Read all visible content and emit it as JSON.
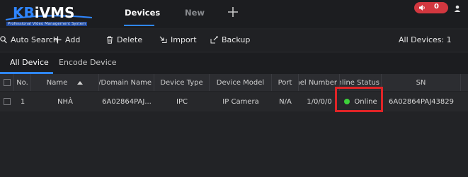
{
  "app": {
    "logo_prefix": "KB",
    "logo_main": "iVMS",
    "logo_subtitle": "Professional Video Management System",
    "top_tabs": [
      "Devices",
      "New"
    ],
    "alarm_count": "0"
  },
  "toolbar": {
    "auto_search": "Auto Search",
    "add": "Add",
    "delete": "Delete",
    "import": "Import",
    "backup": "Backup",
    "all_devices": "All Devices:  1"
  },
  "subtabs": [
    "All Device",
    "Encode Device"
  ],
  "table": {
    "headers": [
      "No.",
      "Name",
      "IP/Domain Name",
      "Device Type",
      "Device Model",
      "Port",
      "Channel Number",
      "Online Status",
      "SN"
    ],
    "rows": [
      {
        "no": "1",
        "name": "NHÀ",
        "ip": "6A02864PAJ...",
        "type": "IPC",
        "model": "IP Camera",
        "port": "N/A",
        "channels": "1/0/0/0",
        "status": "Online",
        "sn": "6A02864PAJ43829"
      }
    ]
  },
  "colors": {
    "accent": "#2f86ff",
    "online": "#3dd23a",
    "alarm": "#d2373f",
    "highlight": "#e02427"
  }
}
